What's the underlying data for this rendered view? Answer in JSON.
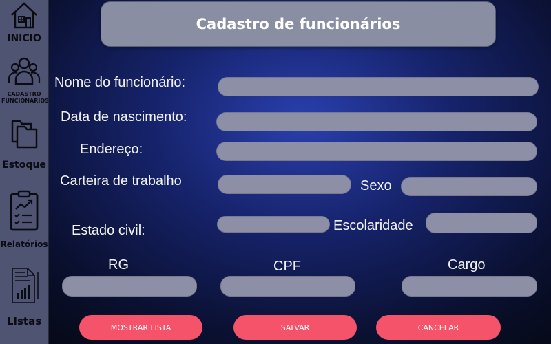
{
  "sidebar": {
    "items": [
      {
        "label": "INICIO",
        "icon": "home-icon"
      },
      {
        "label": "CADASTRO FUNCIONARIOS",
        "icon": "users-icon"
      },
      {
        "label": "Estoque",
        "icon": "folders-icon"
      },
      {
        "label": "Relatórios",
        "icon": "clipboard-chart-icon"
      },
      {
        "label": "LIstas",
        "icon": "document-list-icon"
      }
    ]
  },
  "header": {
    "title": "Cadastro de funcionários"
  },
  "form": {
    "labels": {
      "nome": "Nome do funcionário:",
      "nascimento": "Data de nascimento:",
      "endereco": "Endereço:",
      "carteira": "Carteira de trabalho",
      "sexo": "Sexo",
      "estado_civil": "Estado civil:",
      "escolaridade": "Escolaridade",
      "rg": "RG",
      "cpf": "CPF",
      "cargo": "Cargo"
    },
    "values": {
      "nome": "",
      "nascimento": "",
      "endereco": "",
      "carteira": "",
      "sexo": "",
      "estado_civil": "",
      "escolaridade": "",
      "rg": "",
      "cpf": "",
      "cargo": ""
    }
  },
  "buttons": {
    "mostrar_lista": "MOSTRAR LISTA",
    "salvar": "SALVAR",
    "cancelar": "CANCELAR"
  },
  "colors": {
    "sidebar": "#4f5473",
    "field": "#8d8fa6",
    "button": "#f4536a"
  }
}
